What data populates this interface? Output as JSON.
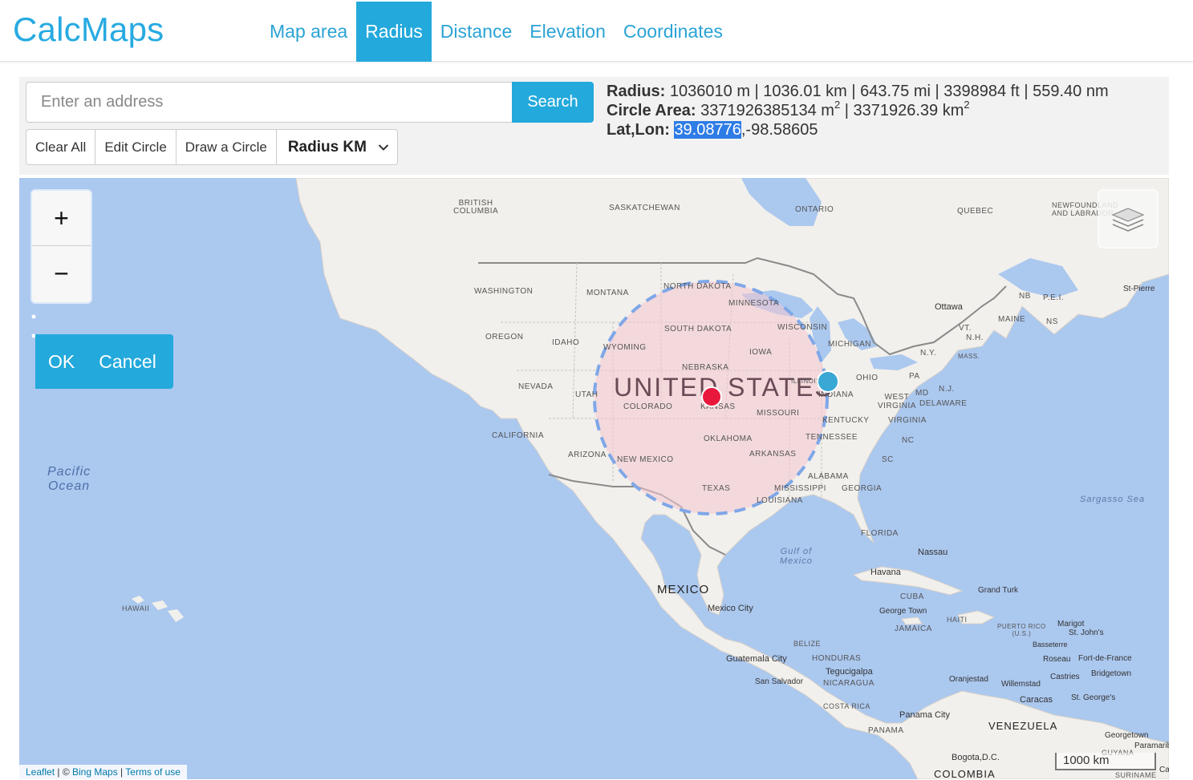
{
  "header": {
    "brand": "CalcMaps",
    "nav": [
      {
        "label": "Map area",
        "active": false
      },
      {
        "label": "Radius",
        "active": true
      },
      {
        "label": "Distance",
        "active": false
      },
      {
        "label": "Elevation",
        "active": false
      },
      {
        "label": "Coordinates",
        "active": false
      }
    ]
  },
  "search": {
    "placeholder": "Enter an address",
    "value": "",
    "button_label": "Search"
  },
  "toolbar": {
    "clear_all": "Clear All",
    "edit_circle": "Edit Circle",
    "draw_circle": "Draw a Circle",
    "unit_select": "Radius KM"
  },
  "stats": {
    "radius_label": "Radius:",
    "radius_value": "1036010 m | 1036.01 km | 643.75 mi | 3398984 ft | 559.40 nm",
    "area_label": "Circle Area:",
    "area_m": "3371926385134 m",
    "area_sep": " | ",
    "area_km": "3371926.39 km",
    "area_exp": "2",
    "latlon_label": "Lat,Lon:",
    "lat": "39.08776",
    "lon": ",-98.58605"
  },
  "map": {
    "zoom_in": "+",
    "zoom_out": "−",
    "ok": "OK",
    "cancel": "Cancel",
    "scale": "1000 km",
    "attribution": {
      "leaflet": "Leaflet",
      "sep1": " | © ",
      "bing": "Bing Maps",
      "sep2": " | ",
      "terms": "Terms of use"
    },
    "colors": {
      "water": "#abc8ef",
      "land": "#f2f0ec",
      "circle_fill": "#f4c6cf",
      "circle_stroke": "#7fa7e8",
      "center_marker": "#e8173c",
      "edge_marker": "#3aa8d4",
      "accent": "#23a9dc"
    },
    "labels": {
      "united_states": "UNITED STATES",
      "mexico": "MEXICO",
      "pacific": "Pacific",
      "ocean": "Ocean",
      "gulf1": "Gulf of",
      "gulf2": "Mexico",
      "sargasso": "Sargasso Sea",
      "british_columbia1": "BRITISH",
      "british_columbia2": "COLUMBIA",
      "saskatchewan": "SASKATCHEWAN",
      "ontario": "ONTARIO",
      "quebec": "QUEBEC",
      "newfoundland1": "NEWFOUNDLAND",
      "newfoundland2": "AND LABRADOR",
      "washington": "WASHINGTON",
      "montana": "MONTANA",
      "north_dakota": "NORTH DAKOTA",
      "minnesota": "MINNESOTA",
      "oregon": "OREGON",
      "idaho": "IDAHO",
      "south_dakota": "SOUTH DAKOTA",
      "wisconsin": "WISCONSIN",
      "michigan": "MICHIGAN",
      "wyoming": "WYOMING",
      "iowa": "IOWA",
      "nebraska": "NEBRASKA",
      "nevada": "NEVADA",
      "utah": "UTAH",
      "colorado": "COLORADO",
      "kansas": "KANSAS",
      "missouri": "MISSOURI",
      "illinois": "ILLINOIS",
      "indiana": "INDIANA",
      "ohio": "OHIO",
      "pa": "PA",
      "california": "CALIFORNIA",
      "arizona": "ARIZONA",
      "new_mexico": "NEW MEXICO",
      "oklahoma": "OKLAHOMA",
      "arkansas": "ARKANSAS",
      "texas": "TEXAS",
      "kentucky": "KENTUCKY",
      "tennessee": "TENNESSEE",
      "west_virginia1": "WEST",
      "west_virginia2": "VIRGINIA",
      "virginia": "VIRGINIA",
      "nc": "NC",
      "sc": "SC",
      "mississippi": "MISSISSIPPI",
      "alabama": "ALABAMA",
      "georgia": "GEORGIA",
      "louisiana": "LOUISIANA",
      "florida": "FLORIDA",
      "md": "MD",
      "nj": "N.J.",
      "delaware": "DELAWARE",
      "ny": "N.Y.",
      "vt": "VT.",
      "nh": "N.H.",
      "mass": "MASS.",
      "maine": "MAINE",
      "nb": "NB",
      "pei": "P.E.I.",
      "ns": "NS",
      "ottawa": "Ottawa",
      "st_pierre": "St-Pierre",
      "hawaii": "HAWAII",
      "mexico_city": "Mexico City",
      "havana": "Havana",
      "nassau": "Nassau",
      "cuba": "CUBA",
      "george_town": "George Town",
      "jamaica": "JAMAICA",
      "haiti": "HAITI",
      "grand_turk": "Grand Turk",
      "puerto_rico1": "PUERTO RICO",
      "puerto_rico2": "(U.S.)",
      "marigot": "Marigot",
      "st_johns": "St. John's",
      "basseterre": "Basseterre",
      "roseau": "Roseau",
      "fort_de_france": "Fort-de-France",
      "castries": "Castries",
      "bridgetown": "Bridgetown",
      "oranjestad": "Oranjestad",
      "willemstad": "Willemstad",
      "caracas": "Caracas",
      "st_georges": "St. George's",
      "belize": "BELIZE",
      "honduras": "HONDURAS",
      "guatemala_city": "Guatemala City",
      "tegucigalpa": "Tegucigalpa",
      "san_salvador": "San Salvador",
      "nicaragua": "NICARAGUA",
      "costa_rica": "COSTA RICA",
      "panama_city": "Panama City",
      "panama": "PANAMA",
      "venezuela": "VENEZUELA",
      "georgetown": "Georgetown",
      "paramaribo": "Paramaribo",
      "guyana": "GUYANA",
      "suriname": "SURINAME",
      "bogota": "Bogota,D.C.",
      "colombia": "COLOMBIA",
      "cayenne": "Ca"
    }
  }
}
